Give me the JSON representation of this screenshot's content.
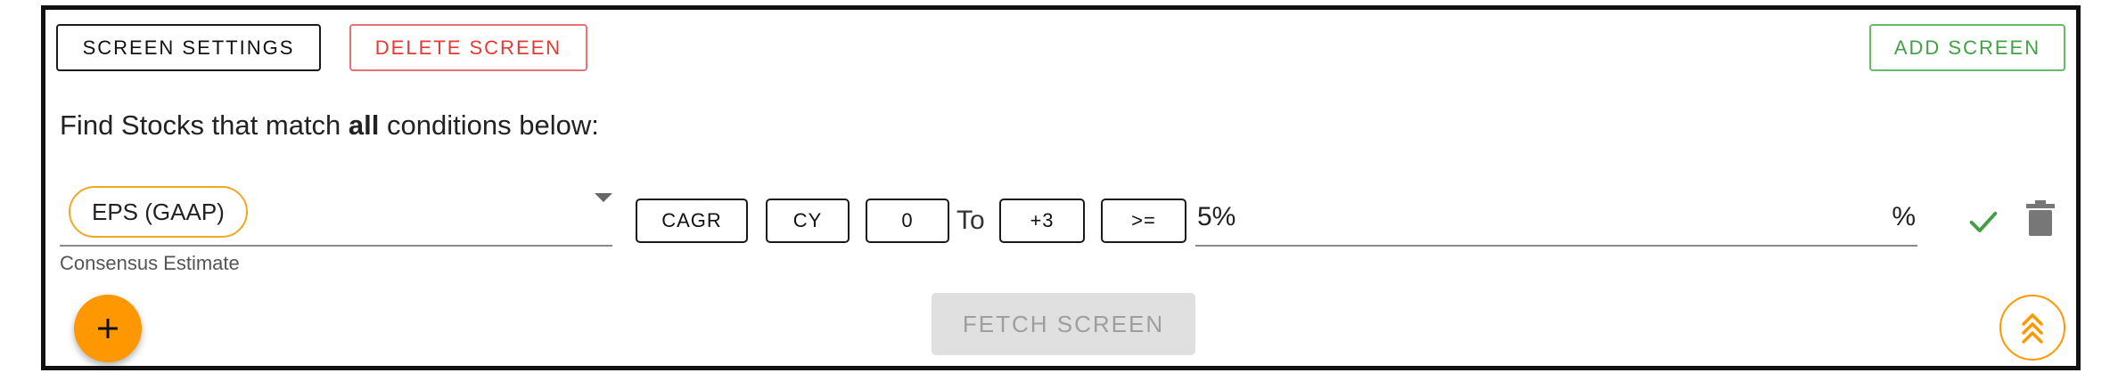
{
  "toolbar": {
    "settings_label": "SCREEN SETTINGS",
    "delete_label": "DELETE SCREEN",
    "add_label": "ADD SCREEN"
  },
  "heading": {
    "prefix": "Find Stocks that match ",
    "emphasis": "all",
    "suffix": " conditions below:"
  },
  "condition": {
    "metric": "EPS (GAAP)",
    "helper": "Consensus Estimate",
    "type": "CAGR",
    "period": "CY",
    "from": "0",
    "to_label": "To",
    "to": "+3",
    "operator": ">=",
    "value": "5%",
    "unit": "%"
  },
  "actions": {
    "fetch_label": "FETCH SCREEN"
  },
  "colors": {
    "accent": "#ff9800",
    "danger": "#e53935",
    "success": "#43a047"
  },
  "icons": [
    "chevron-down-icon",
    "check-icon",
    "trash-icon",
    "plus-icon",
    "double-chevron-up-icon"
  ]
}
